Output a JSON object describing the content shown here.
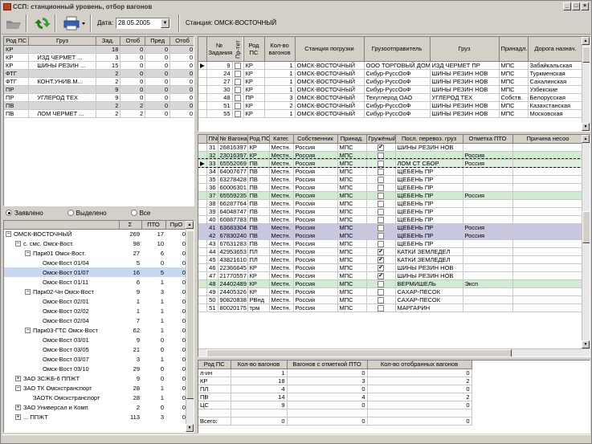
{
  "app": {
    "title": "ССП: станционный уровень, отбор вагонов",
    "accent": "#c8c8e4",
    "green": "#d0ecd0"
  },
  "toolbar": {
    "date_label": "Дата:",
    "date_value": "28.05.2005",
    "station_label": "Станция:",
    "station_value": "ОМСК-ВОСТОЧНЫЙ"
  },
  "leftgrid": {
    "headers": [
      "Род ПС",
      "Груз",
      "Зад.",
      "Отоб",
      "Пред",
      "Отоб"
    ],
    "rows": [
      {
        "g": true,
        "c": [
          "КР",
          "",
          "18",
          "0",
          "0",
          "0"
        ]
      },
      {
        "c": [
          "КР",
          "ИЗД ЧЕРМЕТ ...",
          "3",
          "0",
          "0",
          "0"
        ]
      },
      {
        "c": [
          "КР",
          "ШИНЫ РЕЗИН ...",
          "15",
          "0",
          "0",
          "0"
        ]
      },
      {
        "g": true,
        "c": [
          "ФТГ",
          "",
          "2",
          "0",
          "0",
          "0"
        ]
      },
      {
        "c": [
          "ФТГ",
          "КОНТ.УНИВ.М...",
          "2",
          "0",
          "0",
          "0"
        ]
      },
      {
        "g": true,
        "c": [
          "ПР",
          "",
          "9",
          "0",
          "0",
          "0"
        ]
      },
      {
        "c": [
          "ПР",
          "УГЛЕРОД ТЕХ",
          "9",
          "0",
          "0",
          "0"
        ]
      },
      {
        "g": true,
        "c": [
          "ПВ",
          "",
          "2",
          "2",
          "0",
          "0"
        ]
      },
      {
        "c": [
          "ПВ",
          "ЛОМ ЧЕРМЕТ ...",
          "2",
          "2",
          "0",
          "0"
        ]
      }
    ]
  },
  "filter": {
    "opt1": "Заявлено",
    "opt2": "Выделено",
    "opt3": "Все"
  },
  "tree": {
    "headers": [
      "",
      "Σ",
      "ПТО",
      "ПрО"
    ],
    "rows": [
      {
        "lvl": 0,
        "box": "−",
        "name": "ОМСК-ВОСТОЧНЫЙ",
        "s": "269",
        "p": "17",
        "o": "0"
      },
      {
        "lvl": 1,
        "box": "−",
        "name": "с. смс. Омск-Вост.",
        "s": "98",
        "p": "10",
        "o": "0"
      },
      {
        "lvl": 2,
        "box": "−",
        "name": "Парк01 Омск-Вост.",
        "s": "27",
        "p": "6",
        "o": "0"
      },
      {
        "lvl": 3,
        "box": "",
        "name": "Омск-Вост 01/04",
        "s": "5",
        "p": "0",
        "o": "0"
      },
      {
        "lvl": 3,
        "box": "",
        "name": "Омск-Вост 01/07",
        "s": "16",
        "p": "5",
        "o": "0",
        "sel": true
      },
      {
        "lvl": 3,
        "box": "",
        "name": "Омск-Вост 01/11",
        "s": "6",
        "p": "1",
        "o": "0"
      },
      {
        "lvl": 2,
        "box": "−",
        "name": "Парк02-Чн Омск-Вост",
        "s": "9",
        "p": "3",
        "o": "0"
      },
      {
        "lvl": 3,
        "box": "",
        "name": "Омск-Вост 02/01",
        "s": "1",
        "p": "1",
        "o": "0"
      },
      {
        "lvl": 3,
        "box": "",
        "name": "Омск-Вост 02/02",
        "s": "1",
        "p": "1",
        "o": "0"
      },
      {
        "lvl": 3,
        "box": "",
        "name": "Омск-Вост 02/04",
        "s": "7",
        "p": "1",
        "o": "0"
      },
      {
        "lvl": 2,
        "box": "−",
        "name": "Парк03-ГТС Омск-Вост",
        "s": "62",
        "p": "1",
        "o": "0"
      },
      {
        "lvl": 3,
        "box": "",
        "name": "Омск-Вост 03/01",
        "s": "9",
        "p": "0",
        "o": "0"
      },
      {
        "lvl": 3,
        "box": "",
        "name": "Омск-Вост 03/05",
        "s": "21",
        "p": "0",
        "o": "0"
      },
      {
        "lvl": 3,
        "box": "",
        "name": "Омск-Вост 03/07",
        "s": "3",
        "p": "1",
        "o": "0"
      },
      {
        "lvl": 3,
        "box": "",
        "name": "Омск-Вост 03/10",
        "s": "29",
        "p": "0",
        "o": "0"
      },
      {
        "lvl": 1,
        "box": "+",
        "name": "ЗАО ЗСЖБ-6 ППЖТ",
        "s": "9",
        "p": "0",
        "o": "0"
      },
      {
        "lvl": 1,
        "box": "−",
        "name": "ЗАО ТК Омскстранспорт",
        "s": "28",
        "p": "1",
        "o": "0"
      },
      {
        "lvl": 2,
        "box": "",
        "name": "ЗАОТК Омскстранспорт",
        "s": "28",
        "p": "1",
        "o": "0"
      },
      {
        "lvl": 1,
        "box": "+",
        "name": "ЗАО Универсал и Комп",
        "s": "2",
        "p": "0",
        "o": "0"
      },
      {
        "lvl": 1,
        "box": "+",
        "name": "... ППЖТ",
        "s": "113",
        "p": "3",
        "o": "0"
      }
    ]
  },
  "orders": {
    "headers": [
      "№ Задания",
      "Пр-тет",
      "Род ПС",
      "Кол-во вагонов",
      "Станция погрузки",
      "Грузоотправитель",
      "Груз",
      "Принадл.",
      "Дорога назнач."
    ],
    "rows": [
      {
        "c": [
          "9",
          "",
          "КР",
          "1",
          "ОМСК-ВОСТОЧНЫЙ",
          "ООО ТОРГОВЫЙ ДОМ",
          "ИЗД ЧЕРМЕТ ПР",
          "МПС",
          "Забайкальская"
        ],
        "cur": true
      },
      {
        "c": [
          "24",
          "",
          "КР",
          "1",
          "ОМСК-ВОСТОЧНЫЙ",
          "Сибур-РуссОоФ",
          "ШИНЫ РЕЗИН НОВ",
          "МПС",
          "Туркменская"
        ]
      },
      {
        "c": [
          "27",
          "",
          "КР",
          "1",
          "ОМСК-ВОСТОЧНЫЙ",
          "Сибур-РуссОоФ",
          "ШИНЫ РЕЗИН НОВ",
          "МПС",
          "Сахалинская"
        ]
      },
      {
        "c": [
          "30",
          "",
          "КР",
          "1",
          "ОМСК-ВОСТОЧНЫЙ",
          "Сибур-РуссОоФ",
          "ШИНЫ РЕЗИН НОВ",
          "МПС",
          "Узбекские"
        ]
      },
      {
        "c": [
          "48",
          "",
          "ПР",
          "3",
          "ОМСК-ВОСТОЧНЫЙ",
          "Техуглерод ОАО",
          "УГЛЕРОД ТЕХ",
          "Собств.",
          "Белорусская"
        ]
      },
      {
        "c": [
          "51",
          "",
          "КР",
          "2",
          "ОМСК-ВОСТОЧНЫЙ",
          "Сибур-РуссОоФ",
          "ШИНЫ РЕЗИН НОВ",
          "МПС",
          "Казахстанская"
        ]
      },
      {
        "c": [
          "55",
          "",
          "КР",
          "1",
          "ОМСК-ВОСТОЧНЫЙ",
          "Сибур-РуссОоФ",
          "ШИНЫ РЕЗИН НОВ",
          "МПС",
          "Московская"
        ]
      }
    ]
  },
  "wagons": {
    "headers": [
      "П№",
      "№ Вагона",
      "Род ПС",
      "Катег.",
      "Собственник",
      "Принад.",
      "Гружёный",
      "Посл. перевоз. груз",
      "Отметка ПТО",
      "Причина несоо"
    ],
    "rows": [
      {
        "c": [
          "31",
          "26816397",
          "КР",
          "Местн.",
          "Россия",
          "МПС",
          "1",
          "ШИНЫ РЕЗИН НОВ",
          "",
          ""
        ]
      },
      {
        "c": [
          "32",
          "23016397",
          "КР",
          "Местн.",
          "Россия",
          "МПС",
          "0",
          "",
          "Россия",
          ""
        ],
        "cls": "green"
      },
      {
        "c": [
          "33",
          "65552069",
          "ПВ",
          "Местн.",
          "Россия",
          "МПС",
          "0",
          "ЛОМ СТ СБОР",
          "Россия",
          ""
        ],
        "cls": "selrow",
        "cur": true
      },
      {
        "c": [
          "34",
          "64007677",
          "ПВ",
          "Местн.",
          "Россия",
          "МПС",
          "0",
          "ЩЕБЕНЬ ПР",
          "",
          ""
        ]
      },
      {
        "c": [
          "35",
          "63278428",
          "ПВ",
          "Местн.",
          "Россия",
          "МПС",
          "0",
          "ЩЕБЕНЬ ПР",
          "",
          ""
        ]
      },
      {
        "c": [
          "36",
          "60006301",
          "ПВ",
          "Местн.",
          "Россия",
          "МПС",
          "0",
          "ЩЕБЕНЬ ПР",
          "",
          ""
        ]
      },
      {
        "c": [
          "37",
          "65559235",
          "ПВ",
          "Местн.",
          "Россия",
          "МПС",
          "0",
          "ЩЕБЕНЬ ПР",
          "Россия",
          ""
        ],
        "cls": "green"
      },
      {
        "c": [
          "38",
          "66287764",
          "ПВ",
          "Местн.",
          "Россия",
          "МПС",
          "0",
          "ЩЕБЕНЬ ПР",
          "",
          ""
        ]
      },
      {
        "c": [
          "39",
          "64048747",
          "ПВ",
          "Местн.",
          "Россия",
          "МПС",
          "0",
          "ЩЕБЕНЬ ПР",
          "",
          ""
        ]
      },
      {
        "c": [
          "40",
          "60887783",
          "ПВ",
          "Местн.",
          "Россия",
          "МПС",
          "0",
          "ЩЕБЕНЬ ПР",
          "",
          ""
        ]
      },
      {
        "c": [
          "41",
          "63683304",
          "ПВ",
          "Местн.",
          "Россия",
          "МПС",
          "0",
          "ЩЕБЕНЬ ПР",
          "Россия",
          ""
        ],
        "cls": "purple"
      },
      {
        "c": [
          "42",
          "67830240",
          "ПВ",
          "Местн.",
          "Россия",
          "МПС",
          "0",
          "ЩЕБЕНЬ ПР",
          "Россия",
          ""
        ],
        "cls": "purple"
      },
      {
        "c": [
          "43",
          "67631283",
          "ПВ",
          "Местн.",
          "Россия",
          "МПС",
          "0",
          "ЩЕБЕНЬ ПР",
          "",
          ""
        ]
      },
      {
        "c": [
          "44",
          "42953653",
          "ПЛ",
          "Местн.",
          "Россия",
          "МПС",
          "1",
          "КАТКИ ЗЕМЛЕДЕЛ",
          "",
          ""
        ]
      },
      {
        "c": [
          "45",
          "43821610",
          "ПЛ",
          "Местн.",
          "Россия",
          "МПС",
          "1",
          "КАТКИ ЗЕМЛЕДЕЛ",
          "",
          ""
        ]
      },
      {
        "c": [
          "46",
          "22366645",
          "КР",
          "Местн.",
          "Россия",
          "МПС",
          "1",
          "ШИНЫ РЕЗИН НОВ",
          "",
          ""
        ]
      },
      {
        "c": [
          "47",
          "21770557",
          "КР",
          "Местн.",
          "Россия",
          "МПС",
          "1",
          "ШИНЫ РЕЗИН НОВ",
          "",
          ""
        ]
      },
      {
        "c": [
          "48",
          "24402489",
          "КР",
          "Местн.",
          "Россия",
          "МПС",
          "0",
          "ВЕРМИШЕЛЬ",
          "Эксп",
          ""
        ],
        "cls": "green"
      },
      {
        "c": [
          "49",
          "24405326",
          "КР",
          "Местн.",
          "Россия",
          "МПС",
          "0",
          "САХАР-ПЕСОК",
          "",
          ""
        ]
      },
      {
        "c": [
          "50",
          "90820838",
          "РВнд",
          "Местн.",
          "Россия",
          "МПС",
          "0",
          "САХАР-ПЕСОК",
          "",
          ""
        ]
      },
      {
        "c": [
          "51",
          "80020175",
          "трм",
          "Местн.",
          "Россия",
          "МПС",
          "0",
          "МАРГАРИН",
          "",
          ""
        ]
      }
    ]
  },
  "summary": {
    "headers": [
      "Род ПС",
      "Кол-во вагонов",
      "Вагонов с отметкой ПТО",
      "Кол-во отобранных вагонов"
    ],
    "rows": [
      [
        "л-ин",
        "1",
        "0",
        "0"
      ],
      [
        "КР",
        "18",
        "3",
        "2"
      ],
      [
        "ПЛ",
        "4",
        "0",
        "0"
      ],
      [
        "ПВ",
        "14",
        "4",
        "2"
      ],
      [
        "ЦС",
        "9",
        "0",
        "0"
      ],
      [
        "",
        "",
        "",
        ""
      ]
    ],
    "total_label": "Всего:",
    "total": [
      "0",
      "0",
      "0"
    ]
  }
}
